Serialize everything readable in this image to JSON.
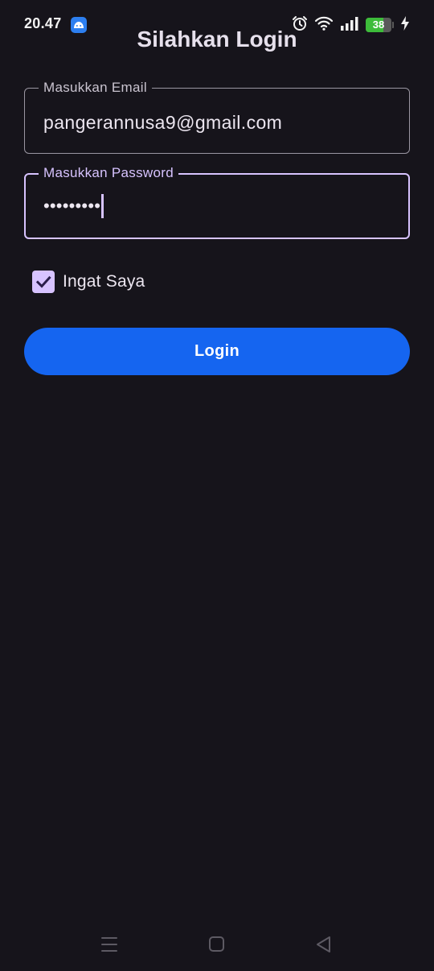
{
  "status_bar": {
    "time": "20.47",
    "app_icon": "android-app-icon",
    "icons": [
      "alarm-icon",
      "wifi-icon",
      "signal-icon",
      "battery-icon",
      "charging-icon"
    ],
    "battery_percent": "38",
    "battery_color": "#3dbc3a"
  },
  "page": {
    "title": "Silahkan Login"
  },
  "email_field": {
    "label": "Masukkan Email",
    "value": "pangerannusa9@gmail.com"
  },
  "password_field": {
    "label": "Masukkan Password",
    "value": "•••••••••",
    "focused": true
  },
  "remember_me": {
    "label": "Ingat Saya",
    "checked": true
  },
  "login_button": {
    "label": "Login"
  },
  "nav_bar": {
    "items": [
      "menu-icon",
      "home-icon",
      "back-icon"
    ]
  },
  "colors": {
    "background": "#16141b",
    "accent": "#d7c3ff",
    "primary_button": "#1565f0",
    "outline": "#9a96a2"
  }
}
